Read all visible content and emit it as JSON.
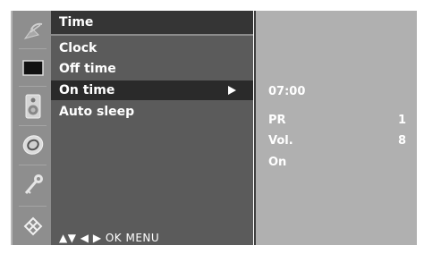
{
  "menu": {
    "title": "Time",
    "items": [
      {
        "label": "Clock"
      },
      {
        "label": "Off time"
      },
      {
        "label": "On time",
        "selected": true
      },
      {
        "label": "Auto sleep"
      }
    ],
    "footer_hint": "▲▼  ◀ ▶  OK  MENU"
  },
  "side_icons": [
    "satellite-dish-icon",
    "screen-icon",
    "speaker-icon",
    "clock-icon",
    "key-icon",
    "option-icon"
  ],
  "on_time_panel": {
    "time": "07:00",
    "pr_label": "PR",
    "pr_value": "1",
    "vol_label": "Vol.",
    "vol_value": "8",
    "state": "On"
  },
  "colors": {
    "menu_bg": "#5b5b5b",
    "header_bg": "#353535",
    "selected_bg": "#2a2a2a",
    "panel_bg": "#b0b0b0",
    "icon_col_bg": "#8e8e8e",
    "text": "#ffffff"
  }
}
